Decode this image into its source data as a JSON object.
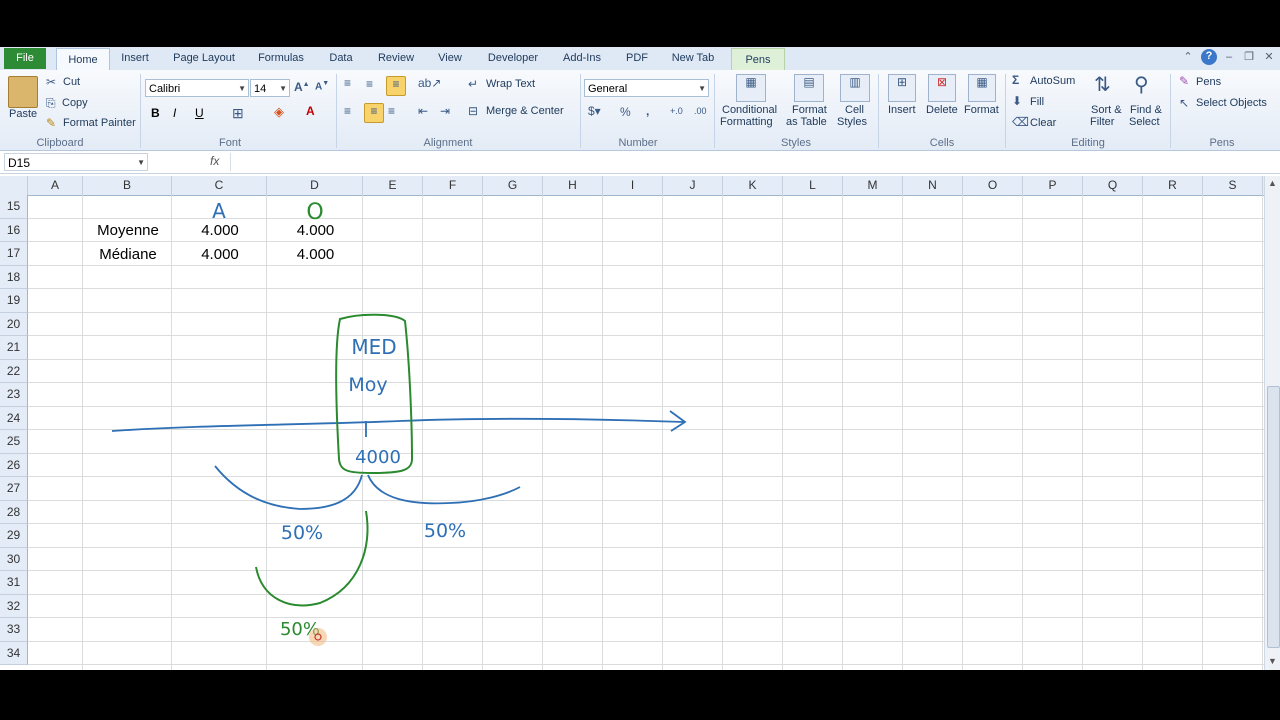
{
  "tabs": [
    "File",
    "Home",
    "Insert",
    "Page Layout",
    "Formulas",
    "Data",
    "Review",
    "View",
    "Developer",
    "Add-Ins",
    "PDF",
    "New Tab",
    "Pens"
  ],
  "clipboard": {
    "paste": "Paste",
    "cut": "Cut",
    "copy": "Copy",
    "format_painter": "Format Painter",
    "label": "Clipboard"
  },
  "font": {
    "name": "Calibri",
    "size": "14",
    "label": "Font",
    "bold": "B",
    "italic": "I",
    "underline": "U"
  },
  "alignment": {
    "wrap_text": "Wrap Text",
    "merge_center": "Merge & Center",
    "label": "Alignment"
  },
  "number": {
    "format": "General",
    "percent": "%",
    "comma": ",",
    "label": "Number"
  },
  "styles": {
    "conditional": "Conditional",
    "formatting": "Formatting",
    "format_as": "Format",
    "as_table": "as Table",
    "cell": "Cell",
    "cell_styles": "Styles",
    "label": "Styles"
  },
  "cells": {
    "insert": "Insert",
    "delete": "Delete",
    "format": "Format",
    "label": "Cells"
  },
  "editing": {
    "autosum": "AutoSum",
    "fill": "Fill",
    "clear": "Clear",
    "sort": "Sort &",
    "filter": "Filter",
    "find": "Find &",
    "select": "Select",
    "label": "Editing"
  },
  "pens": {
    "pens": "Pens",
    "select_objects": "Select Objects",
    "label": "Pens"
  },
  "formula_bar": {
    "name_box": "D15",
    "fx": "fx",
    "value": ""
  },
  "columns": [
    "A",
    "B",
    "C",
    "D",
    "E",
    "F",
    "G",
    "H",
    "I",
    "J",
    "K",
    "L",
    "M",
    "N",
    "O",
    "P",
    "Q",
    "R",
    "S"
  ],
  "rows": [
    "15",
    "16",
    "17",
    "18",
    "19",
    "20",
    "21",
    "22",
    "23",
    "24",
    "25",
    "26",
    "27",
    "28",
    "29",
    "30",
    "31",
    "32",
    "33",
    "34"
  ],
  "cells_data": {
    "b16": "Moyenne",
    "c16": "4.000",
    "d16": "4.000",
    "b17": "Médiane",
    "c17": "4.000",
    "d17": "4.000"
  },
  "ink": {
    "letter_c": "A",
    "letter_d": "O",
    "med": "MED",
    "moy": "Moy",
    "value": "4000",
    "left_pct": "50%",
    "right_pct": "50%",
    "bottom_pct": "50%"
  },
  "colors": {
    "ink_blue": "#2e6fb5",
    "ink_green": "#2a8a2f",
    "file_tab": "#2d8a35"
  }
}
